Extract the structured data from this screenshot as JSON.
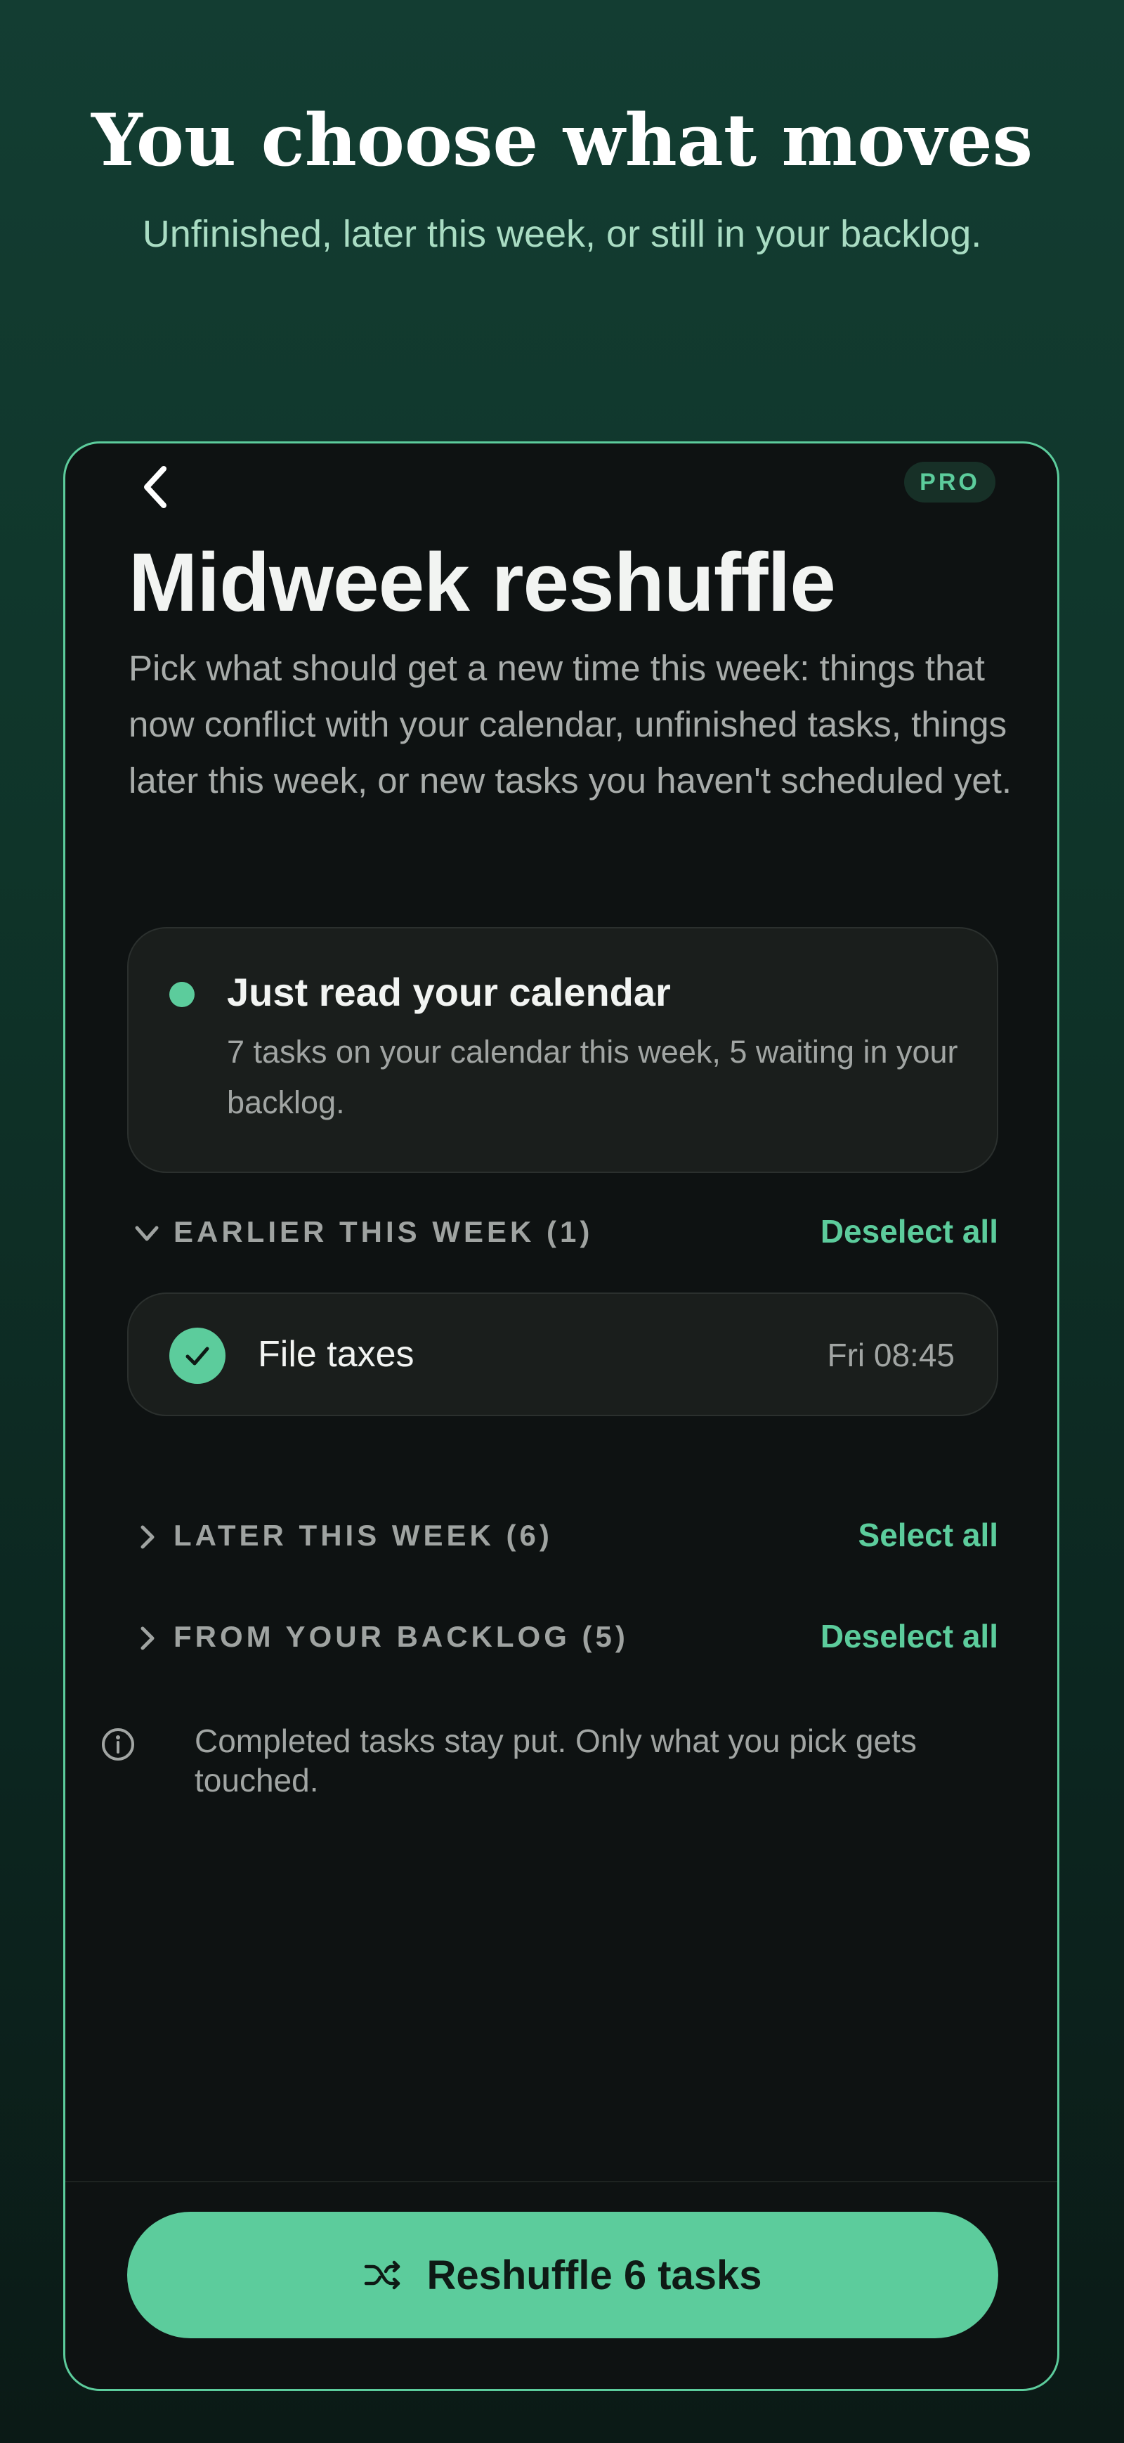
{
  "hero": {
    "title": "You choose what moves",
    "subtitle": "Unfinished, later this week, or still in your backlog."
  },
  "screen": {
    "back_icon": "chevron-left-icon",
    "badge": "PRO",
    "title": "Midweek reshuffle",
    "description": "Pick what should get a new time this week: things that now conflict with your calendar, unfinished tasks, things later this week, or new tasks you haven't scheduled yet."
  },
  "status_card": {
    "indicator_color": "#5ccc9c",
    "title": "Just read your calendar",
    "text": "7 tasks on your calendar this week, 5 waiting in your backlog."
  },
  "sections": [
    {
      "label": "EARLIER THIS WEEK (1)",
      "action": "Deselect all",
      "expanded": true,
      "tasks": [
        {
          "title": "File taxes",
          "time": "Fri 08:45",
          "selected": true
        }
      ]
    },
    {
      "label": "LATER THIS WEEK (6)",
      "action": "Select all",
      "expanded": false
    },
    {
      "label": "FROM YOUR BACKLOG (5)",
      "action": "Deselect all",
      "expanded": false
    }
  ],
  "info": {
    "icon": "info-icon",
    "text": "Completed tasks stay put. Only what you pick gets touched."
  },
  "cta": {
    "icon": "shuffle-icon",
    "label": "Reshuffle 6 tasks"
  },
  "colors": {
    "accent": "#5ccc9c",
    "panel": "#0e1212",
    "card": "#1a1e1c"
  }
}
